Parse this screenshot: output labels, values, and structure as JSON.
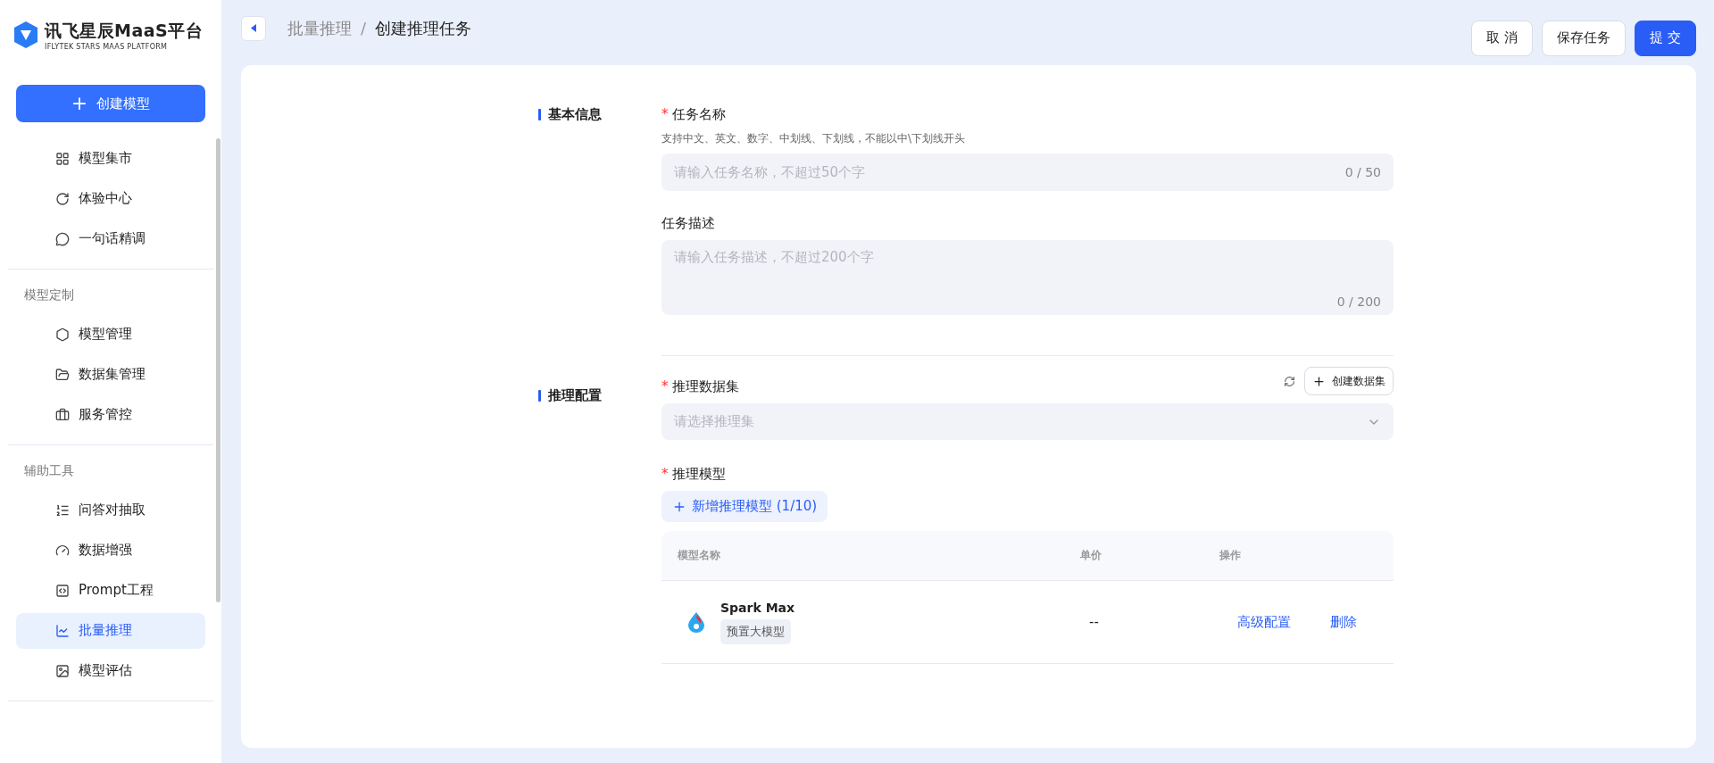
{
  "logo": {
    "title": "讯飞星辰MaaS平台",
    "subtitle": "IFLYTEK STARS MAAS PLATFORM"
  },
  "create_button": {
    "icon": "+",
    "label": "创建模型"
  },
  "nav_groups": [
    {
      "items": [
        {
          "label": "模型集市",
          "selected": false
        },
        {
          "label": "体验中心",
          "selected": false
        },
        {
          "label": "一句话精调",
          "selected": false
        }
      ]
    },
    {
      "heading": "模型定制",
      "items": [
        {
          "label": "模型管理",
          "selected": false
        },
        {
          "label": "数据集管理",
          "selected": false
        },
        {
          "label": "服务管控",
          "selected": false
        }
      ]
    },
    {
      "heading": "辅助工具",
      "items": [
        {
          "label": "问答对抽取",
          "selected": false
        },
        {
          "label": "数据增强",
          "selected": false
        },
        {
          "label": "Prompt工程",
          "selected": false
        },
        {
          "label": "批量推理",
          "selected": true
        },
        {
          "label": "模型评估",
          "selected": false
        }
      ]
    }
  ],
  "breadcrumb": [
    {
      "label": "批量推理"
    },
    {
      "label": "创建推理任务"
    }
  ],
  "breadcrumb_separator": "/",
  "required_mark": "*",
  "header_buttons": [
    {
      "label": "取 消",
      "kind": "default"
    },
    {
      "label": "保存任务",
      "kind": "default"
    },
    {
      "label": "提 交",
      "kind": "primary"
    }
  ],
  "basic_section": {
    "title": "基本信息",
    "name_field": {
      "label": "任务名称",
      "required": true,
      "hint": "支持中文、英文、数字、中划线、下划线，不能以中\\下划线开头",
      "placeholder": "请输入任务名称，不超过50个字",
      "counter": "0 / 50"
    },
    "desc_field": {
      "label": "任务描述",
      "required": false,
      "placeholder": "请输入任务描述，不超过200个字",
      "counter": "0 / 200"
    }
  },
  "config_section": {
    "title": "推理配置",
    "dataset_field": {
      "label": "推理数据集",
      "required": true,
      "placeholder": "请选择推理集",
      "create_button": "创建数据集"
    },
    "model_field": {
      "label": "推理模型",
      "required": true,
      "add_button": "新增推理模型 (1/10)",
      "table": {
        "columns": [
          "模型名称",
          "单价",
          "操作"
        ],
        "rows": [
          {
            "name": "Spark Max",
            "tag": "预置大模型",
            "price": "--",
            "actions": [
              "高级配置",
              "删除"
            ]
          }
        ]
      }
    }
  }
}
